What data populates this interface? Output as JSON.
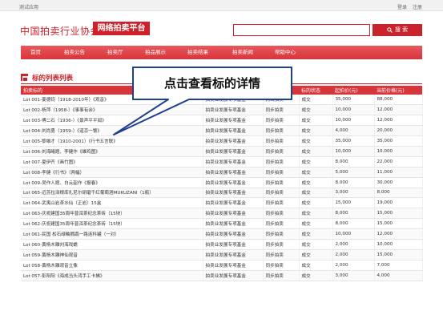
{
  "topbar": {
    "app_label": "测试应用",
    "login": "登录",
    "register": "注册"
  },
  "header": {
    "org_name": "中国拍卖行业协会",
    "platform_badge": "网络拍卖平台"
  },
  "search": {
    "placeholder": "",
    "button_label": "搜 索"
  },
  "nav": {
    "items": [
      "首页",
      "拍卖公告",
      "拍卖厅",
      "拍品展示",
      "拍卖结果",
      "拍卖新闻",
      "帮助中心"
    ]
  },
  "section": {
    "title": "标的列表列表"
  },
  "table": {
    "headers": [
      "拍卖标的",
      "",
      "",
      "标的状态",
      "起拍价(元)",
      "当前价格(元)"
    ],
    "rows": [
      [
        "Lot 001-姜德钧（1918-2010年）《观音》",
        "拍卖业发展专项基金",
        "网络拍卖",
        "成交",
        "35,000",
        "88,000"
      ],
      [
        "Lot 002-杨萍（1958-）《事事有余》",
        "拍卖业发展专项基金",
        "同步拍卖",
        "成交",
        "10,000",
        "12,000"
      ],
      [
        "Lot 003-傅二石（1936-）《景声平平闻》",
        "拍卖业发展专项基金",
        "同步拍卖",
        "成交",
        "10,000",
        "12,000"
      ],
      [
        "Lot 004-刘尚勇（1959-）《道京一瞥》",
        "拍卖业发展专项基金",
        "同步拍卖",
        "成交",
        "4,000",
        "20,000"
      ],
      [
        "Lot 005-黎雄才（1910-2001）《行书五言联》",
        "拍卖业发展专项基金",
        "同步拍卖",
        "成交",
        "35,000",
        "35,000"
      ],
      [
        "Lot 006-刘海曦题、李健作《雄鸡图》",
        "拍卖业发展专项基金",
        "同步拍卖",
        "成交",
        "10,000",
        "10,000"
      ],
      [
        "Lot 007-夏伊齐《画竹图》",
        "拍卖业发展专项基金",
        "同步拍卖",
        "成交",
        "8,000",
        "22,000"
      ],
      [
        "Lot 008-李健《行书》（两幅）",
        "拍卖业发展专项基金",
        "同步拍卖",
        "成交",
        "5,000",
        "11,000"
      ],
      [
        "Lot 009-吴作人题、白云韶作《报春》",
        "拍卖业发展专项基金",
        "同步拍卖",
        "成交",
        "8,000",
        "30,000"
      ],
      [
        "Lot 065-迈苏拉泽根库扎尼尔研磨千红葡萄酒MUKUZANI（1瓶）",
        "拍卖业发展专项基金",
        "同步拍卖",
        "成交",
        "3,000",
        "8,000"
      ],
      [
        "Lot 064-武夷山岩茶水仙（正岩）15盒",
        "拍卖业发展专项基金",
        "同步拍卖",
        "成交",
        "15,000",
        "19,000"
      ],
      [
        "Lot 063-庆祝建国35周年普洱茶纪念茶砖（15块）",
        "拍卖业发展专项基金",
        "同步拍卖",
        "成交",
        "8,000",
        "15,000"
      ],
      [
        "Lot 062-庆祝建国35周年普洱茶纪念茶砖（15块）",
        "拍卖业发展专项基金",
        "同步拍卖",
        "成交",
        "8,000",
        "15,000"
      ],
      [
        "Lot 061-民国 松石绿釉鹦鹉一路连科罐（一对）",
        "拍卖业发展专项基金",
        "同步拍卖",
        "成交",
        "10,000",
        "12,000"
      ],
      [
        "Lot 060-黄杨木雕刘海戏蟾",
        "拍卖业发展专项基金",
        "同步拍卖",
        "成交",
        "2,000",
        "10,000"
      ],
      [
        "Lot 059-黄杨木雕神仙观音",
        "拍卖业发展专项基金",
        "同步拍卖",
        "成交",
        "2,000",
        "15,000"
      ],
      [
        "Lot 058-黄杨木雕观音立像",
        "拍卖业发展专项基金",
        "同步拍卖",
        "成交",
        "2,000",
        "7,000"
      ],
      [
        "Lot 057-彭阳阳《海成当头鸿手工卡拂》",
        "拍卖业发展专项基金",
        "同步拍卖",
        "成交",
        "3,000",
        "4,000"
      ]
    ]
  },
  "callout": {
    "text": "点击查看标的详情"
  },
  "colors": {
    "brand_red": "#d0202a",
    "nav_red": "#d8353b",
    "callout_border": "#1f3f8f"
  }
}
